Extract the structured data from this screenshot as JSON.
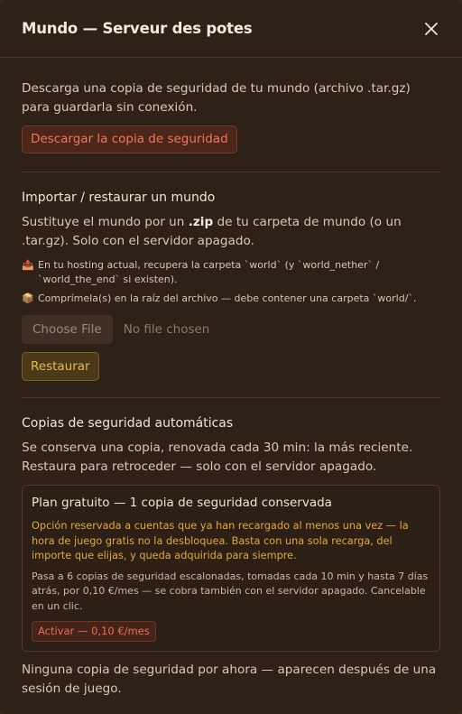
{
  "header": {
    "title": "Mundo — Serveur des potes",
    "close_icon": "close-icon"
  },
  "download": {
    "text": "Descarga una copia de seguridad de tu mundo (archivo .tar.gz) para guardarla sin conexión.",
    "button_label": "Descargar la copia de seguridad"
  },
  "import": {
    "heading": "Importar / restaurar un mundo",
    "text_before": "Sustituye el mundo por un ",
    "text_bold": ".zip",
    "text_after": " de tu carpeta de mundo (o un .tar.gz). Solo con el servidor apagado.",
    "note1_icon": "📤",
    "note1": "En tu hosting actual, recupera la carpeta `world` (y `world_nether` / `world_the_end` si existen).",
    "note2_icon": "📦",
    "note2": "Comprímela(s) en la raíz del archivo — debe contener una carpeta `world/`.",
    "choose_file_label": "Choose File",
    "no_file_label": "No file chosen",
    "restore_label": "Restaurar"
  },
  "auto_backups": {
    "heading": "Copias de seguridad automáticas",
    "text": "Se conserva una copia, renovada cada 30 min: la más reciente. Restaura para retroceder — solo con el servidor apagado.",
    "plan": {
      "title": "Plan gratuito — 1 copia de seguridad conservada",
      "warning": "Opción reservada a cuentas que ya han recargado al menos una vez — la hora de juego gratis no la desbloquea. Basta con una sola recarga, del importe que elijas, y queda adquirida para siempre.",
      "description": "Pasa a 6 copias de seguridad escalonadas, tomadas cada 10 min y hasta 7 días atrás, por 0,10 €/mes — se cobra también con el servidor apagado. Cancelable en un clic.",
      "activate_label": "Activar — 0,10 €/mes"
    },
    "empty_text": "Ninguna copia de seguridad por ahora — aparecen después de una sesión de juego."
  },
  "colors": {
    "background": "#2e2118",
    "danger": "#f07757",
    "gold": "#e9b74a",
    "warning_text": "#e3a93c"
  }
}
